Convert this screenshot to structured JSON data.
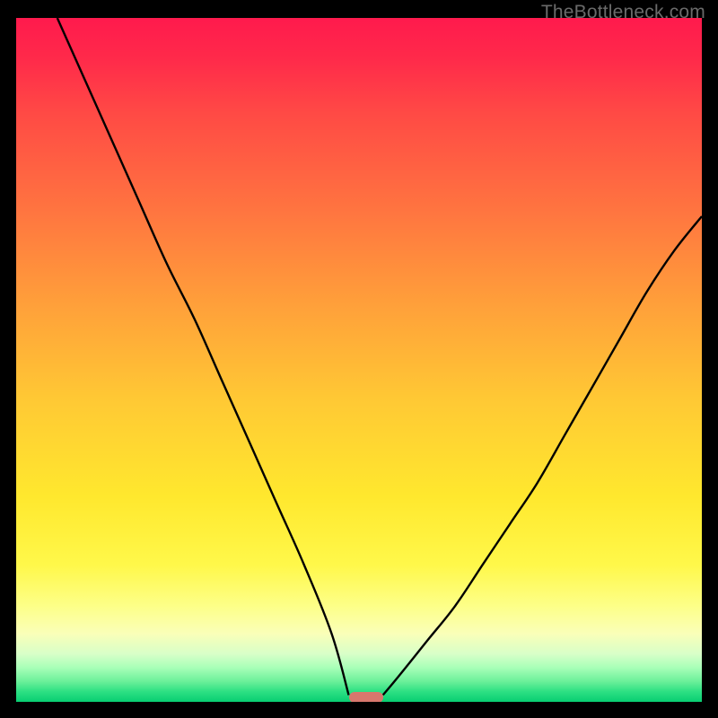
{
  "watermark": {
    "text": "TheBottleneck.com"
  },
  "chart_data": {
    "type": "line",
    "title": "",
    "xlabel": "",
    "ylabel": "",
    "xlim": [
      0,
      100
    ],
    "ylim": [
      0,
      100
    ],
    "grid": false,
    "legend": false,
    "series": [
      {
        "name": "left-branch",
        "x": [
          6,
          10,
          14,
          18,
          22,
          26,
          30,
          34,
          38,
          42,
          46,
          48.5
        ],
        "y": [
          100,
          91,
          82,
          73,
          64,
          56,
          47,
          38,
          29,
          20,
          10,
          1
        ]
      },
      {
        "name": "right-branch",
        "x": [
          53.5,
          56,
          60,
          64,
          68,
          72,
          76,
          80,
          84,
          88,
          92,
          96,
          100
        ],
        "y": [
          1,
          4,
          9,
          14,
          20,
          26,
          32,
          39,
          46,
          53,
          60,
          66,
          71
        ]
      }
    ],
    "marker": {
      "x_center": 51,
      "width": 5,
      "y": 0.7,
      "color": "#d8776d"
    },
    "background_gradient": {
      "top": "#ff1a4d",
      "mid": "#ffd633",
      "bottom": "#08ce72"
    }
  }
}
